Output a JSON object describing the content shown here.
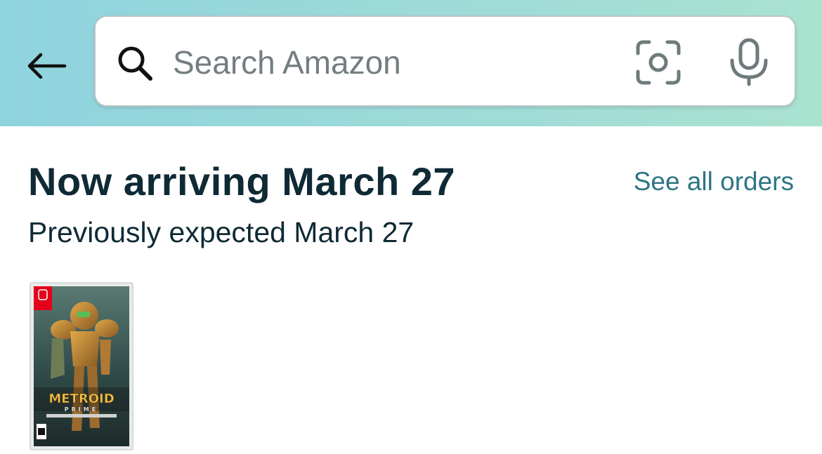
{
  "search": {
    "placeholder": "Search Amazon"
  },
  "header": {
    "back_icon": "arrow-left-icon",
    "search_icon": "magnifier-icon",
    "camera_icon": "camera-scan-icon",
    "mic_icon": "microphone-icon"
  },
  "delivery": {
    "title": "Now arriving March 27",
    "subtitle": "Previously expected March 27",
    "see_all_link": "See all orders"
  },
  "product": {
    "box_title": "METROID",
    "box_subtitle": "PRIME"
  },
  "colors": {
    "title_text": "#0f2a35",
    "link": "#2e7584",
    "placeholder": "#737e80",
    "header_start": "#8fd3de",
    "header_end": "#a9e2cf"
  }
}
